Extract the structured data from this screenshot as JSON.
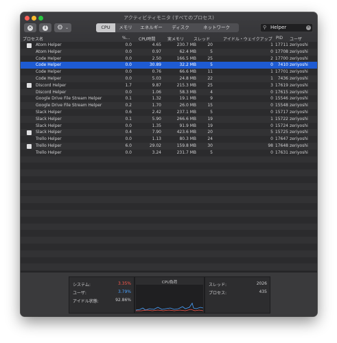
{
  "window": {
    "title": "アクティビティモニタ (すべてのプロセス)"
  },
  "toolbar": {
    "close_icon_glyph": "✕",
    "info_icon_glyph": "i",
    "gear_glyph": "⚙",
    "chevron_glyph": "⌄",
    "tabs": [
      "CPU",
      "メモリ",
      "エネルギー",
      "ディスク",
      "ネットワーク"
    ],
    "active_tab": "CPU",
    "search_icon_glyph": "⚲",
    "search_value": "Helper",
    "clear_glyph": "✕"
  },
  "columns": {
    "name": "プロセス名",
    "percent": "%...",
    "cpu_time": "CPU時間",
    "real_mem": "実メモリ",
    "threads": "スレッド",
    "idle_wake": "アイドル・ウェイクアップ",
    "pid": "PID",
    "user": "ユーザ"
  },
  "processes": [
    {
      "name": "Atom Helper",
      "pct": "0.0",
      "time": "4.65",
      "mem": "230.7 MB",
      "threads": "20",
      "wake": "1",
      "pid": "17711",
      "user": "zeriyoshi",
      "icon": true
    },
    {
      "name": "Atom Helper",
      "pct": "0.0",
      "time": "0.97",
      "mem": "62.4 MB",
      "threads": "5",
      "wake": "0",
      "pid": "17708",
      "user": "zeriyoshi",
      "icon": false
    },
    {
      "name": "Code Helper",
      "pct": "0.0",
      "time": "2.50",
      "mem": "166.5 MB",
      "threads": "25",
      "wake": "2",
      "pid": "17700",
      "user": "zeriyoshi",
      "icon": false
    },
    {
      "name": "Code Helper",
      "pct": "0.0",
      "time": "30.89",
      "mem": "32.2 MB",
      "threads": "5",
      "wake": "0",
      "pid": "7410",
      "user": "zeriyoshi",
      "icon": false,
      "selected": true
    },
    {
      "name": "Code Helper",
      "pct": "0.0",
      "time": "0.76",
      "mem": "66.6 MB",
      "threads": "11",
      "wake": "1",
      "pid": "17701",
      "user": "zeriyoshi",
      "icon": false
    },
    {
      "name": "Code Helper",
      "pct": "0.0",
      "time": "5.03",
      "mem": "24.8 MB",
      "threads": "22",
      "wake": "1",
      "pid": "7436",
      "user": "zeriyoshi",
      "icon": false
    },
    {
      "name": "Discord Helper",
      "pct": "1.7",
      "time": "9.87",
      "mem": "215.3 MB",
      "threads": "25",
      "wake": "3",
      "pid": "17619",
      "user": "zeriyoshi",
      "icon": true
    },
    {
      "name": "Discord Helper",
      "pct": "0.0",
      "time": "1.06",
      "mem": "58.3 MB",
      "threads": "4",
      "wake": "0",
      "pid": "17615",
      "user": "zeriyoshi",
      "icon": false
    },
    {
      "name": "Google Drive File Stream Helper",
      "pct": "0.1",
      "time": "1.32",
      "mem": "19.1 MB",
      "threads": "9",
      "wake": "0",
      "pid": "15546",
      "user": "zeriyoshi",
      "icon": false
    },
    {
      "name": "Google Drive File Stream Helper",
      "pct": "0.2",
      "time": "1.70",
      "mem": "26.0 MB",
      "threads": "15",
      "wake": "0",
      "pid": "15548",
      "user": "zeriyoshi",
      "icon": false
    },
    {
      "name": "Slack Helper",
      "pct": "0.6",
      "time": "2.42",
      "mem": "237.1 MB",
      "threads": "5",
      "wake": "0",
      "pid": "15717",
      "user": "zeriyoshi",
      "icon": false
    },
    {
      "name": "Slack Helper",
      "pct": "0.1",
      "time": "5.90",
      "mem": "266.6 MB",
      "threads": "19",
      "wake": "1",
      "pid": "15722",
      "user": "zeriyoshi",
      "icon": false
    },
    {
      "name": "Slack Helper",
      "pct": "0.0",
      "time": "1.35",
      "mem": "91.9 MB",
      "threads": "19",
      "wake": "0",
      "pid": "15724",
      "user": "zeriyoshi",
      "icon": false
    },
    {
      "name": "Slack Helper",
      "pct": "0.4",
      "time": "7.90",
      "mem": "423.6 MB",
      "threads": "20",
      "wake": "5",
      "pid": "15725",
      "user": "zeriyoshi",
      "icon": true
    },
    {
      "name": "Trello Helper",
      "pct": "0.0",
      "time": "1.13",
      "mem": "80.3 MB",
      "threads": "24",
      "wake": "0",
      "pid": "17647",
      "user": "zeriyoshi",
      "icon": false
    },
    {
      "name": "Trello Helper",
      "pct": "6.0",
      "time": "29.02",
      "mem": "159.8 MB",
      "threads": "30",
      "wake": "98",
      "pid": "17648",
      "user": "zeriyoshi",
      "icon": true
    },
    {
      "name": "Trello Helper",
      "pct": "0.0",
      "time": "3.24",
      "mem": "231.7 MB",
      "threads": "5",
      "wake": "0",
      "pid": "17631",
      "user": "zeriyoshi",
      "icon": false
    }
  ],
  "summary": {
    "system_label": "システム:",
    "system_value": "3.35%",
    "user_label": "ユーザ:",
    "user_value": "3.79%",
    "idle_label": "アイドル状態:",
    "idle_value": "92.86%",
    "cpu_load_title": "CPU負荷",
    "threads_label": "スレッド:",
    "threads_value": "2026",
    "processes_label": "プロセス:",
    "processes_value": "435"
  },
  "colors": {
    "system": "#ff5a4e",
    "user": "#4aa2ff",
    "selection": "#1e5bd3"
  }
}
